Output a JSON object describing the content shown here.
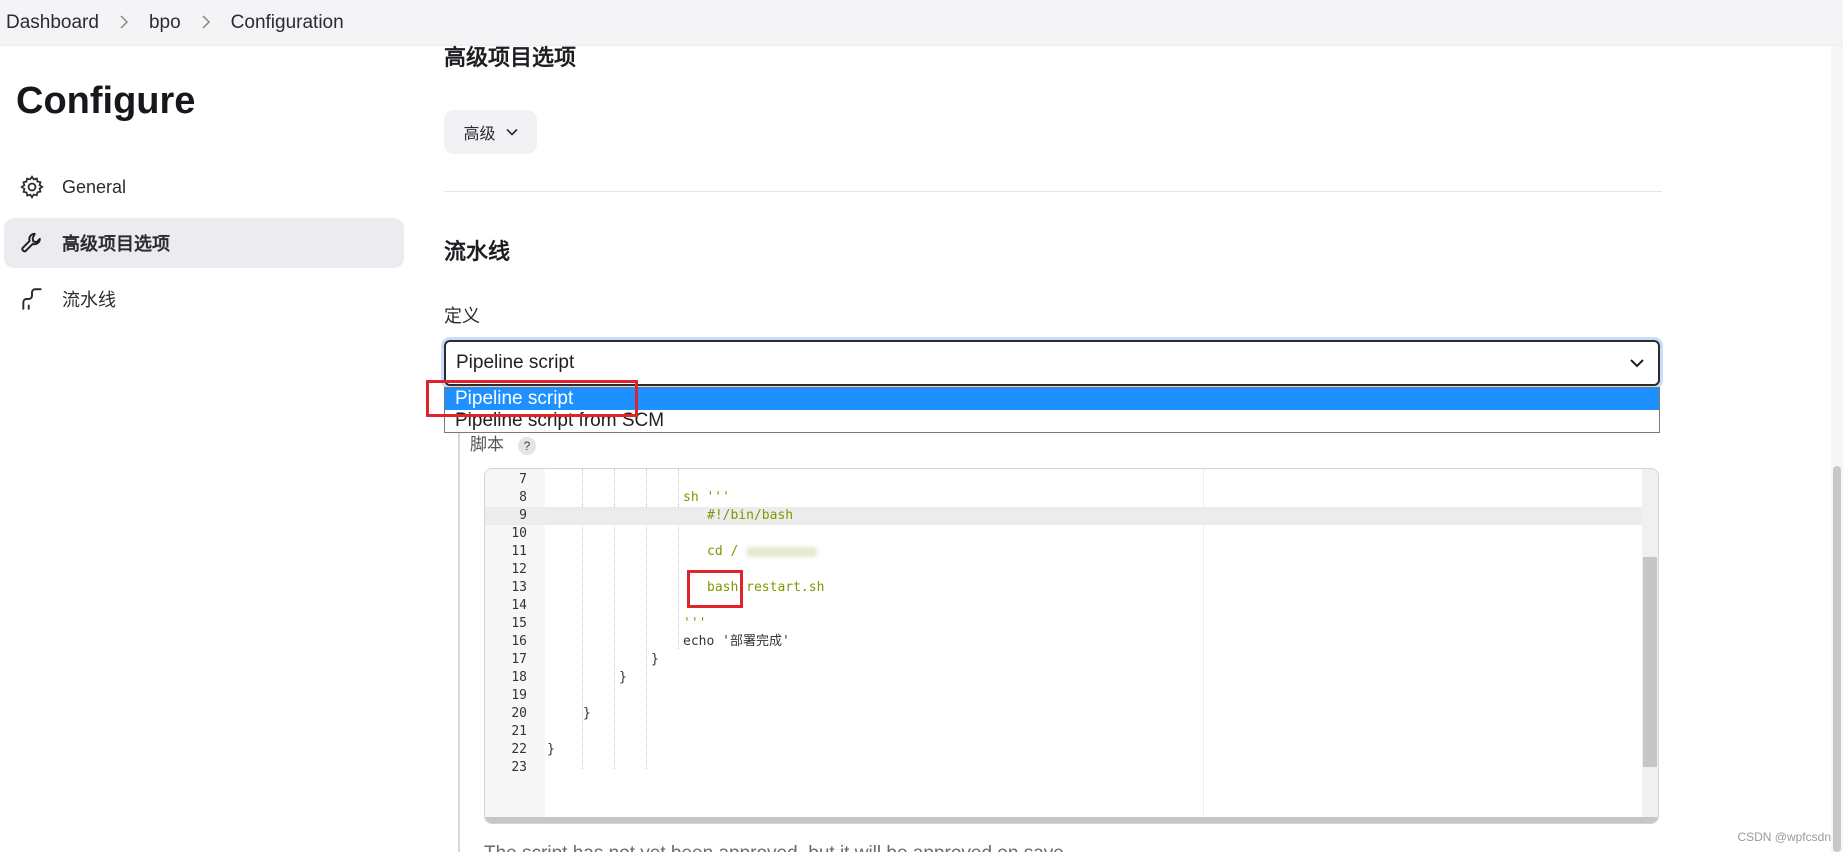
{
  "breadcrumb": {
    "items": [
      "Dashboard",
      "bpo",
      "Configuration"
    ]
  },
  "sidebar": {
    "title": "Configure",
    "items": [
      {
        "label": "General",
        "icon": "gear-icon"
      },
      {
        "label": "高级项目选项",
        "icon": "wrench-icon",
        "active": true
      },
      {
        "label": "流水线",
        "icon": "pipeline-icon"
      }
    ]
  },
  "advanced": {
    "heading": "高级项目选项",
    "button_label": "高级"
  },
  "pipeline": {
    "heading": "流水线",
    "definition_label": "定义",
    "selected": "Pipeline script",
    "options": [
      "Pipeline script",
      "Pipeline script from SCM"
    ],
    "script_label": "脚本",
    "help_icon": "?",
    "editor_lines": [
      {
        "n": "7",
        "text": ""
      },
      {
        "n": "8",
        "text": "sh '''"
      },
      {
        "n": "9",
        "text": "#!/bin/bash"
      },
      {
        "n": "10",
        "text": ""
      },
      {
        "n": "11",
        "text": "cd /"
      },
      {
        "n": "12",
        "text": ""
      },
      {
        "n": "13",
        "text": "bash restart.sh"
      },
      {
        "n": "14",
        "text": ""
      },
      {
        "n": "15",
        "text": "'''"
      },
      {
        "n": "16",
        "text": "echo '部署完成'"
      },
      {
        "n": "17",
        "text": "}"
      },
      {
        "n": "18",
        "text": "}"
      },
      {
        "n": "19",
        "text": ""
      },
      {
        "n": "20",
        "text": "}"
      },
      {
        "n": "21",
        "text": ""
      },
      {
        "n": "22",
        "text": "}"
      },
      {
        "n": "23",
        "text": ""
      }
    ],
    "approval_note": "The script has not yet been approved, but it will be approved on save"
  },
  "watermark": "CSDN @wpfcsdn",
  "colors": {
    "accent": "#1e90ff",
    "highlight_box": "#e0242b",
    "string": "#7a9a00"
  }
}
